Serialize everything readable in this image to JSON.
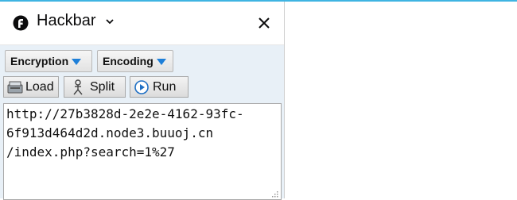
{
  "header": {
    "title": "Hackbar",
    "icon": "firefox-addon-icon",
    "close_icon": "close-icon"
  },
  "toolbar": {
    "encryption_label": "Encryption",
    "encoding_label": "Encoding",
    "load_label": "Load",
    "split_label": "Split",
    "run_label": "Run"
  },
  "url_field": {
    "value": "http://27b3828d-2e2e-4162-93fc-6f913d464d2d.node3.buuoj.cn/index.php?search=1%27",
    "line1": "http://27b3828d-2e2e-4162-93fc-",
    "line2": "6f913d464d2d.node3.buuoj.cn",
    "line3": "/index.php?search=1%27"
  },
  "colors": {
    "accent": "#3fb4e2",
    "panel_bg": "#e8f0f7",
    "dropdown_arrow": "#1e7fd8"
  }
}
